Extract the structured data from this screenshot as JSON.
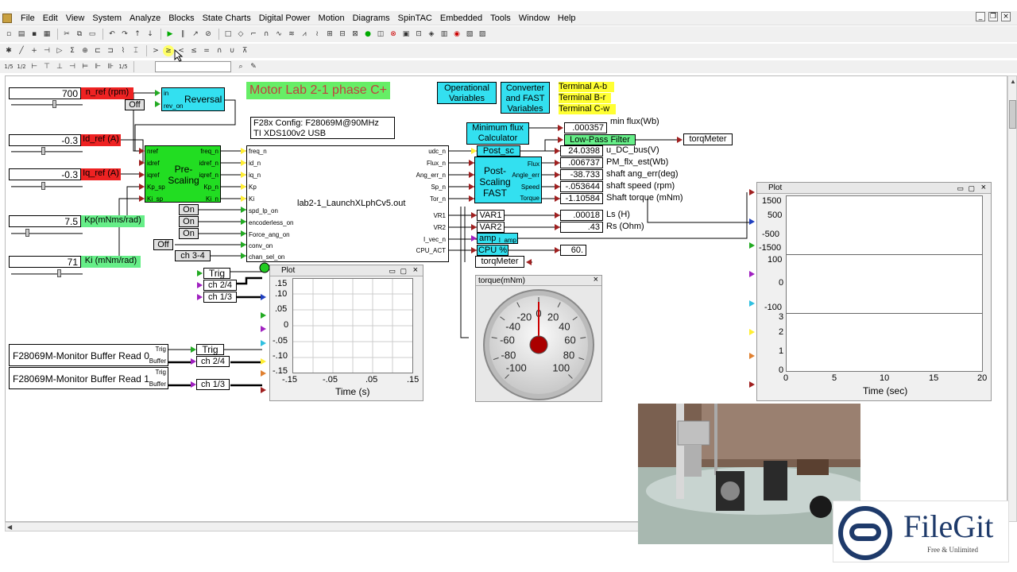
{
  "menu": [
    "File",
    "Edit",
    "View",
    "System",
    "Analyze",
    "Blocks",
    "State Charts",
    "Digital Power",
    "Motion",
    "Diagrams",
    "SpinTAC",
    "Embedded",
    "Tools",
    "Window",
    "Help"
  ],
  "toolbar3": [
    "1/5",
    "1/2",
    "1/5"
  ],
  "diagram": {
    "title": "Motor Lab 2-1 phase C+",
    "op_vars": "Operational Variables",
    "conv_fast": "Converter and FAST Variables",
    "terminals": [
      "Terminal A-b",
      "Terminal B-r",
      "Terminal C-w"
    ],
    "config_line1": "F28x Config: F28069M@90MHz",
    "config_line2": "TI XDS100v2 USB",
    "out_file": "lab2-1_LaunchXLphCv5.out",
    "inputs": [
      {
        "value": "700",
        "label": "n_ref (rpm)"
      },
      {
        "value": "-0.3",
        "label": "Id_ref (A)"
      },
      {
        "value": "-0.3",
        "label": "Iq_ref (A)"
      },
      {
        "value": "7.5",
        "label": "Kp(mNms/rad)"
      },
      {
        "value": "71",
        "label": "Ki (mNm/rad)"
      }
    ],
    "off_btn1": "Off",
    "off_btn2": "Off",
    "reversal": "Reversal",
    "reversal_ports": [
      "in",
      "rev_on"
    ],
    "prescaling": "Pre-Scaling",
    "pre_in_ports": [
      "nref",
      "idref",
      "iqref",
      "Kp_sp",
      "Ki_sp"
    ],
    "pre_out_ports": [
      "freq_n",
      "idref_n",
      "iqref_n",
      "Kp_n",
      "Ki_n"
    ],
    "on_buttons": [
      "On",
      "On",
      "On"
    ],
    "ch34": "ch 3-4",
    "dsp_in_ports": [
      "freq_n",
      "id_n",
      "iq_n",
      "Kp",
      "Ki",
      "spd_lp_on",
      "encoderless_on",
      "Force_ang_on",
      "conv_on",
      "chan_sel_on"
    ],
    "dsp_out_ports": [
      "udc_n",
      "Flux_n",
      "Ang_err_n",
      "Sp_n",
      "Tor_n",
      "VR1",
      "VR2",
      "I_vec_n",
      "CPU_ACT"
    ],
    "min_flux_calc": "Minimum flux Calculator",
    "min_flux_val": ".000357",
    "min_flux_label": "min flux(Wb)",
    "lpf": "Low-Pass Filter",
    "torq_meter": "torqMeter",
    "post_sc": "Post_sc",
    "postscaling": "Post-Scaling FAST",
    "post_out_ports": [
      "Flux",
      "Angle_err",
      "Speed",
      "Torque"
    ],
    "readouts": [
      {
        "value": "24.0398",
        "label": "u_DC_bus(V)"
      },
      {
        "value": ".006737",
        "label": "PM_flx_est(Wb)"
      },
      {
        "value": "-38.733",
        "label": "shaft ang_err(deg)"
      },
      {
        "value": "-.053644",
        "label": "shaft speed (rpm)"
      },
      {
        "value": "-1.10584",
        "label": "Shaft torque (mNm)"
      }
    ],
    "var1": "VAR1",
    "var2": "VAR2",
    "ls_val": ".00018",
    "ls_label": "Ls (H)",
    "rs_val": ".43",
    "rs_label": "Rs (Ohm)",
    "amp": "amp",
    "amp_port": "I_amp",
    "cpu": "CPU %",
    "cpu_val": "60.",
    "torq_meter2": "torqMeter",
    "trig": "Trig",
    "ch24": "ch 2/4",
    "ch13": "ch 1/3",
    "monitor0": "F28069M-Monitor Buffer Read 0",
    "monitor1": "F28069M-Monitor Buffer Read 1",
    "mon_ports": [
      "Trig",
      "Buffer"
    ],
    "trig2": "Trig",
    "ch24b": "ch 2/4",
    "ch13b": "ch 1/3"
  },
  "plot_small": {
    "title": "Plot",
    "yticks": [
      ".15",
      ".10",
      ".05",
      "0",
      "-.05",
      "-.10",
      "-.15"
    ],
    "xticks": [
      "-.15",
      "-.05",
      ".05",
      ".15"
    ],
    "xlabel": "Time (s)"
  },
  "gauge": {
    "title": "torque(mNm)",
    "ticks": [
      "-100",
      "-80",
      "-60",
      "-40",
      "-20",
      "0",
      "20",
      "40",
      "60",
      "80",
      "100"
    ],
    "value": 0
  },
  "plot_big": {
    "title": "Plot",
    "y1ticks": [
      "1500",
      "500",
      "-500",
      "-1500"
    ],
    "y2ticks": [
      "100",
      "0",
      "-100"
    ],
    "y3ticks": [
      "3",
      "2",
      "1",
      "0"
    ],
    "xticks": [
      "0",
      "5",
      "10",
      "15",
      "20"
    ],
    "xlabel": "Time (sec)"
  },
  "logo": {
    "name": "FileGit",
    "tagline": "Free & Unlimited"
  },
  "colors": {
    "cyan": "#33e0f0",
    "green": "#22dd22",
    "yellow": "#ffff33",
    "red": "#ee2222"
  }
}
